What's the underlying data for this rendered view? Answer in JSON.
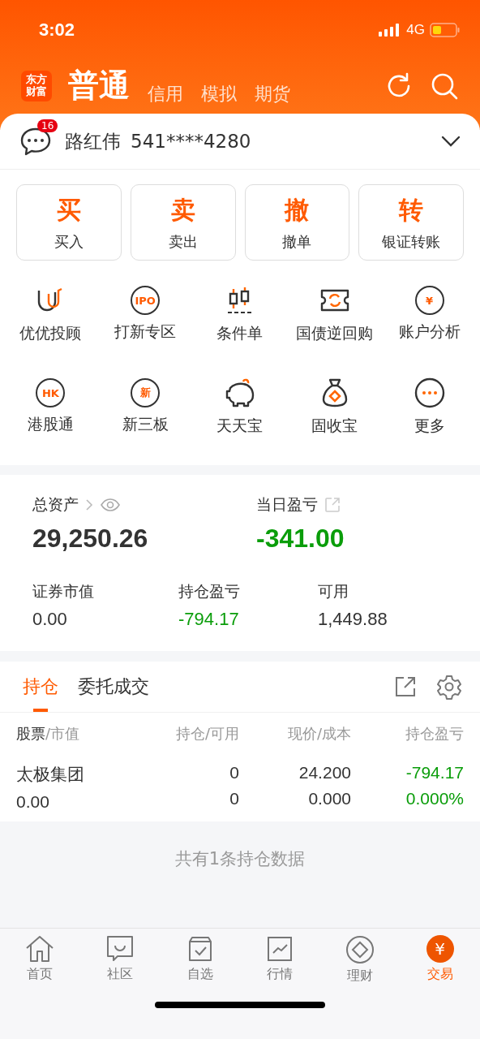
{
  "status_bar": {
    "time": "3:02",
    "network": "4G"
  },
  "header": {
    "logo": [
      "东方",
      "财富"
    ],
    "tabs": [
      {
        "label": "普通",
        "selected": true
      },
      {
        "label": "信用",
        "selected": false
      },
      {
        "label": "模拟",
        "selected": false
      },
      {
        "label": "期货",
        "selected": false
      }
    ]
  },
  "account": {
    "badge": "16",
    "name": "路红伟",
    "number": "541****4280"
  },
  "actions": [
    {
      "glyph": "买",
      "label": "买入"
    },
    {
      "glyph": "卖",
      "label": "卖出"
    },
    {
      "glyph": "撤",
      "label": "撤单"
    },
    {
      "glyph": "转",
      "label": "银证转账"
    }
  ],
  "shortcuts": [
    {
      "label": "优优投顾"
    },
    {
      "label": "打新专区",
      "icon_text": "IPO"
    },
    {
      "label": "条件单"
    },
    {
      "label": "国债逆回购"
    },
    {
      "label": "账户分析",
      "icon_text": "¥"
    },
    {
      "label": "港股通",
      "icon_text": "HK"
    },
    {
      "label": "新三板",
      "icon_text": "新"
    },
    {
      "label": "天天宝"
    },
    {
      "label": "固收宝"
    },
    {
      "label": "更多"
    }
  ],
  "assets": {
    "total_label": "总资产",
    "total": "29,250.26",
    "daily_label": "当日盈亏",
    "daily": "-341.00",
    "stats": [
      {
        "label": "证券市值",
        "value": "0.00",
        "negative": false
      },
      {
        "label": "持仓盈亏",
        "value": "-794.17",
        "negative": true
      },
      {
        "label": "可用",
        "value": "1,449.88",
        "negative": false
      }
    ]
  },
  "position_tabs": [
    {
      "label": "持仓",
      "selected": true
    },
    {
      "label": "委托成交",
      "selected": false
    }
  ],
  "table": {
    "columns": [
      {
        "main": "股票",
        "sub": "/市值"
      },
      {
        "sub": "持仓/可用"
      },
      {
        "sub": "现价/成本"
      },
      {
        "sub": "持仓盈亏"
      }
    ],
    "rows": [
      {
        "name": "太极集团",
        "value": "0.00",
        "held": "0",
        "available": "0",
        "price": "24.200",
        "cost": "0.000",
        "pl": "-794.17",
        "pl_pct": "0.000%"
      }
    ]
  },
  "summary": "共有1条持仓数据",
  "bottom_nav": [
    {
      "label": "首页",
      "selected": false
    },
    {
      "label": "社区",
      "selected": false
    },
    {
      "label": "自选",
      "selected": false
    },
    {
      "label": "行情",
      "selected": false
    },
    {
      "label": "理财",
      "selected": false
    },
    {
      "label": "交易",
      "selected": true,
      "icon_text": "¥"
    }
  ]
}
